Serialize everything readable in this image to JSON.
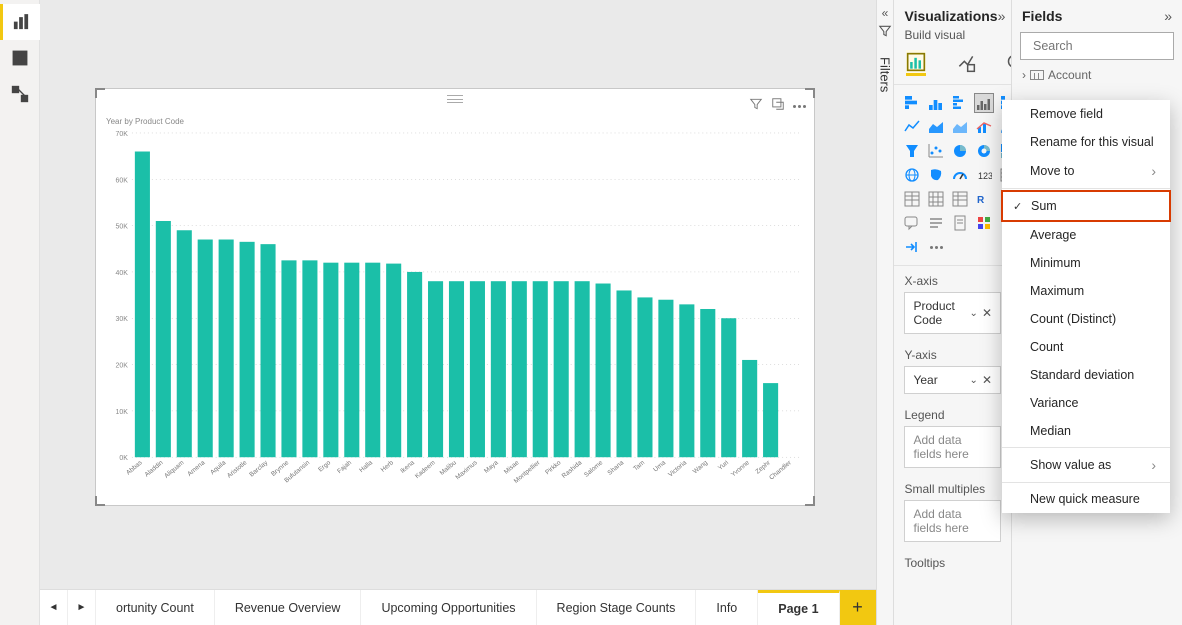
{
  "panels": {
    "visualizations": "Visualizations",
    "build_visual": "Build visual",
    "fields": "Fields",
    "filters": "Filters"
  },
  "search": {
    "placeholder": "Search"
  },
  "field_tree": {
    "account": "Account"
  },
  "wells": {
    "xaxis_label": "X-axis",
    "xaxis_value": "Product Code",
    "yaxis_label": "Y-axis",
    "yaxis_value": "Year",
    "legend_label": "Legend",
    "legend_placeholder": "Add data fields here",
    "small_label": "Small multiples",
    "small_placeholder": "Add data fields here",
    "tooltips_label": "Tooltips"
  },
  "tabs": {
    "t1": "ortunity Count",
    "t2": "Revenue Overview",
    "t3": "Upcoming Opportunities",
    "t4": "Region Stage Counts",
    "t5": "Info",
    "t6": "Page 1"
  },
  "context_menu": {
    "remove": "Remove field",
    "rename": "Rename for this visual",
    "moveto": "Move to",
    "sum": "Sum",
    "average": "Average",
    "minimum": "Minimum",
    "maximum": "Maximum",
    "count_distinct": "Count (Distinct)",
    "count": "Count",
    "stddev": "Standard deviation",
    "variance": "Variance",
    "median": "Median",
    "show_as": "Show value as",
    "new_quick": "New quick measure"
  },
  "chart": {
    "title": "Year by Product Code"
  },
  "chart_data": {
    "type": "bar",
    "title": "Year by Product Code",
    "xlabel": "Product Code",
    "ylabel": "",
    "ylim": [
      0,
      70000
    ],
    "yticks": [
      "0K",
      "10K",
      "20K",
      "30K",
      "40K",
      "50K",
      "60K",
      "70K"
    ],
    "categories": [
      "Abbas",
      "Aladdin",
      "Aliquam",
      "Amena",
      "Aquila",
      "Aristotle",
      "Barclay",
      "Brynne",
      "Bufutansin",
      "Ergo",
      "Fajah",
      "Halla",
      "Herb",
      "Ikena",
      "Kadeem",
      "Malibu",
      "Maximus",
      "Maya",
      "Misae",
      "Montpellier",
      "Pirkko",
      "Rashida",
      "Salome",
      "Shana",
      "Tam",
      "Uma",
      "Victoria",
      "Wang",
      "Yuri",
      "Yvonne",
      "Zephr",
      "Chandler"
    ],
    "values": [
      66000,
      51000,
      49000,
      47000,
      47000,
      46500,
      46000,
      42500,
      42500,
      42000,
      42000,
      42000,
      41800,
      40000,
      38000,
      38000,
      38000,
      38000,
      38000,
      38000,
      38000,
      38000,
      37500,
      36000,
      34500,
      34000,
      33000,
      32000,
      30000,
      21000,
      16000,
      0
    ],
    "bar_color": "#1bbfa8"
  }
}
